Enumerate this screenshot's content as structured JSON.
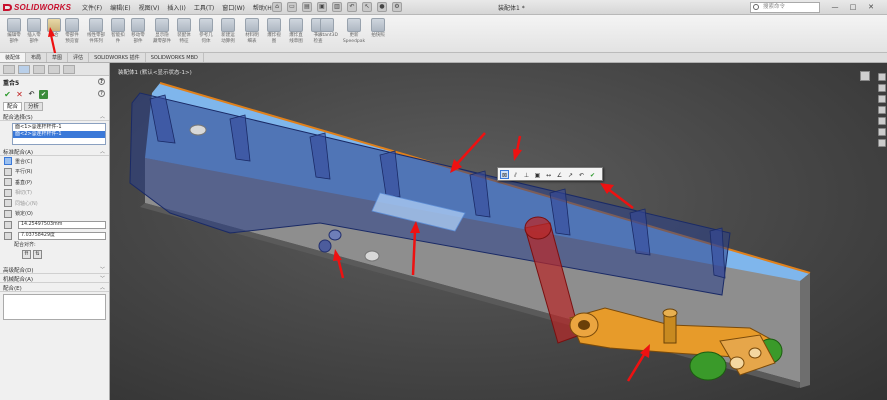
{
  "app": {
    "logo_text": "SOLIDWORKS",
    "menus": [
      "文件(F)",
      "编辑(E)",
      "视图(V)",
      "插入(I)",
      "工具(T)",
      "窗口(W)",
      "帮助(H)"
    ],
    "document_title": "装配体1 *",
    "search_placeholder": "搜索命令",
    "window_buttons": [
      "—",
      "□",
      "✕"
    ]
  },
  "ribbon": {
    "buttons": [
      {
        "label": "编辑零\n部件"
      },
      {
        "label": "插入零\n部件"
      },
      {
        "label": "配合"
      },
      {
        "label": "零部件\n预览窗"
      },
      {
        "label": "线性零部\n件阵列"
      },
      {
        "label": "智能扣\n件"
      },
      {
        "label": "移动零\n部件"
      },
      {
        "label": "显示隐\n藏零部件"
      },
      {
        "label": "装配体\n特征"
      },
      {
        "label": "参考几\n何体"
      },
      {
        "label": "新建运\n动算例"
      },
      {
        "label": "材料明\n细表"
      },
      {
        "label": "爆炸视\n图"
      },
      {
        "label": "爆炸直\n线草图"
      },
      {
        "label": "干涉\n检查"
      },
      {
        "label": "Instant3D"
      },
      {
        "label": "更新\nSpeedpak"
      },
      {
        "label": "拍快照"
      }
    ]
  },
  "tabs": [
    "装配体",
    "布局",
    "草图",
    "评估",
    "SOLIDWORKS 插件",
    "SOLIDWORKS MBD"
  ],
  "property_manager": {
    "title": "重合5",
    "help": "?",
    "sub_tabs": [
      "配合",
      "分析"
    ],
    "selections_header": "配合选择(S)",
    "selections": [
      "面<1>@连杆杆件-1",
      "面<2>@连杆杆件-1"
    ],
    "standard_header": "标准配合(A)",
    "mates": [
      "重合(C)",
      "平行(R)",
      "垂直(P)",
      "相切(T)",
      "同轴心(N)",
      "锁定(O)"
    ],
    "distance_value": "14.25497503mm",
    "angle_value": "7.03758429度",
    "align_label": "配合对齐:",
    "advanced_header": "高级配合(D)",
    "mechanical_header": "机械配合(A)",
    "comments_header": "配合(E)"
  },
  "viewport": {
    "breadcrumb": "装配体1 (默认<显示状态-1>)"
  }
}
